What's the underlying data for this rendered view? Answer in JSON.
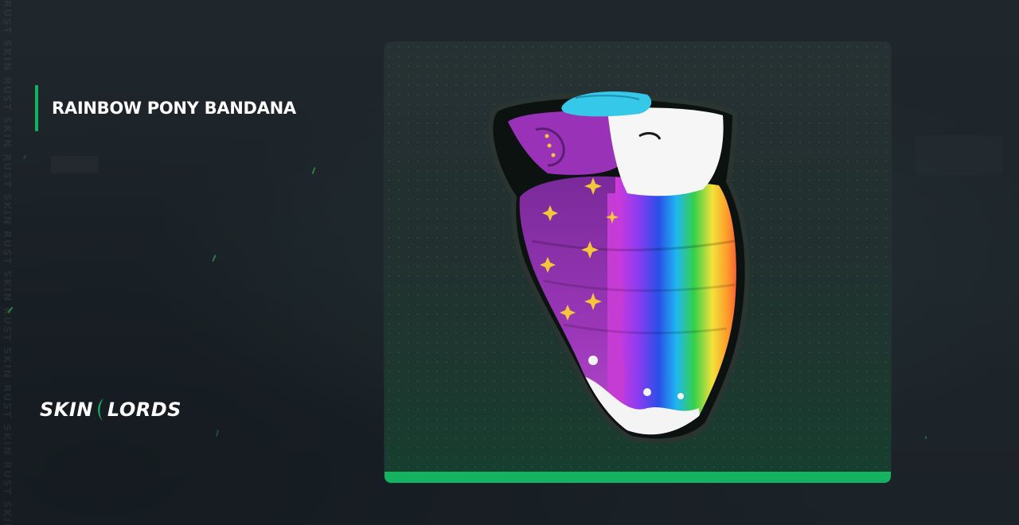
{
  "item": {
    "title": "RAINBOW PONY BANDANA",
    "image_icon": "rainbow-pony-bandana-image"
  },
  "brand": {
    "left": "SKIN",
    "right": "LORDS"
  },
  "watermark": "RUST SKIN RUST SKIN RUST SKIN RUST SKIN RUST SKIN RUST SKIN RUST SKIN",
  "colors": {
    "accent": "#13b35f",
    "background": "#1c2329",
    "card": "#22302f"
  }
}
